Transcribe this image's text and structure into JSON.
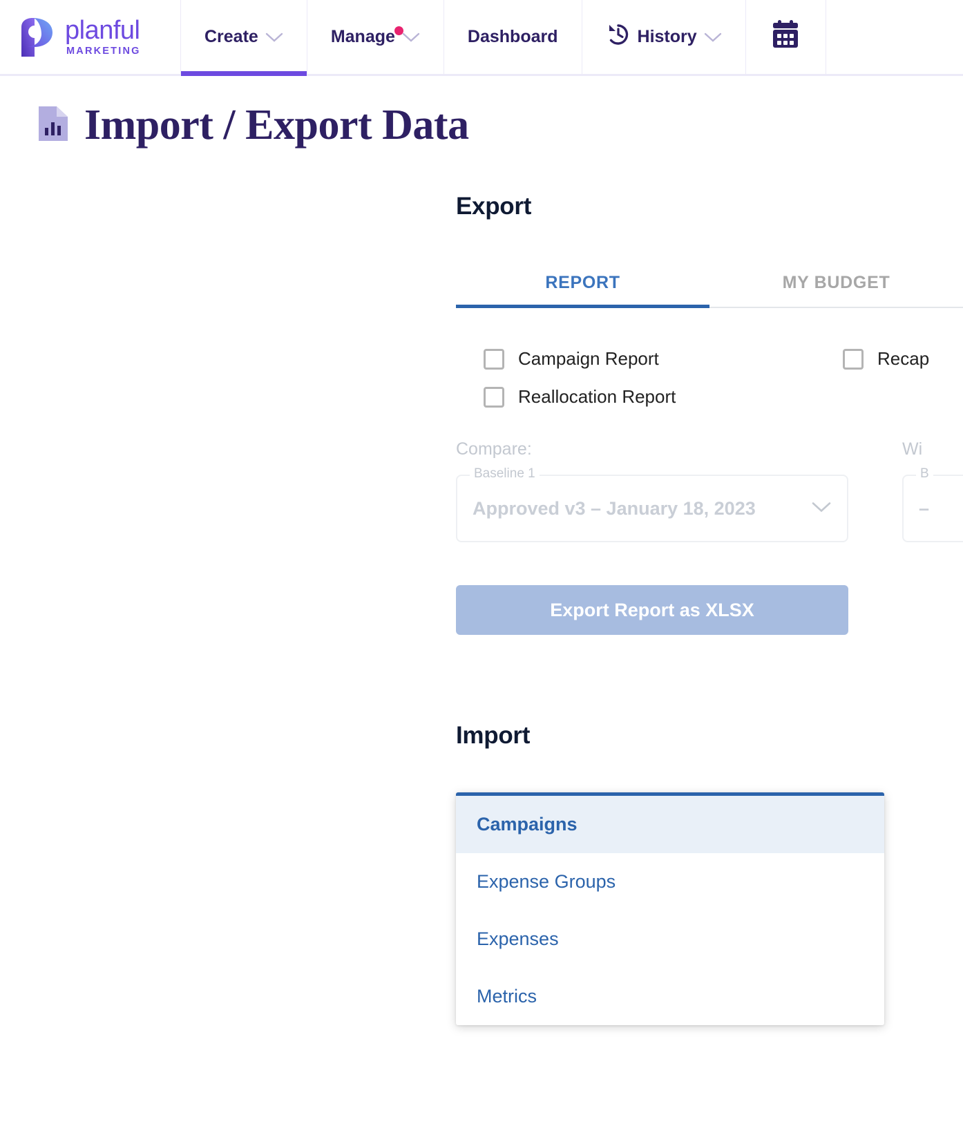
{
  "brand": {
    "name": "planful",
    "tagline": "MARKETING",
    "accent_color": "#6d4ae0",
    "logo_icon": "planful-p-logo"
  },
  "topnav": {
    "items": [
      {
        "label": "Create",
        "has_caret": true,
        "active": true,
        "badge": false
      },
      {
        "label": "Manage",
        "has_caret": true,
        "active": false,
        "badge": true
      },
      {
        "label": "Dashboard",
        "has_caret": false,
        "active": false,
        "badge": false
      },
      {
        "label": "History",
        "has_caret": true,
        "active": false,
        "badge": false,
        "icon": "history-clock-icon"
      }
    ],
    "calendar_icon": "calendar-icon",
    "active_underline_color": "#6d4ae0",
    "badge_color": "#e8236f"
  },
  "page": {
    "title": "Import / Export Data",
    "title_icon": "document-chart-icon"
  },
  "export": {
    "heading": "Export",
    "tabs": [
      {
        "label": "REPORT",
        "active": true
      },
      {
        "label": "MY BUDGET",
        "active": false
      }
    ],
    "active_tab_color": "#2b63ab",
    "checkboxes": [
      {
        "label": "Campaign Report",
        "checked": false
      },
      {
        "label": "Recap",
        "checked": false,
        "truncated": true
      },
      {
        "label": "Reallocation Report",
        "checked": false
      }
    ],
    "compare": {
      "label": "Compare:",
      "legend": "Baseline 1",
      "value": "Approved v3 – January 18, 2023",
      "disabled": true
    },
    "with": {
      "label": "Wi",
      "legend": "B",
      "value": "–",
      "disabled": true,
      "truncated": true
    },
    "button_label": "Export Report as XLSX",
    "button_color": "#a7bce0"
  },
  "import": {
    "heading": "Import",
    "dropdown_accent": "#2b63ab",
    "options": [
      {
        "label": "Campaigns",
        "selected": true
      },
      {
        "label": "Expense Groups",
        "selected": false
      },
      {
        "label": "Expenses",
        "selected": false
      },
      {
        "label": "Metrics",
        "selected": false
      }
    ]
  }
}
